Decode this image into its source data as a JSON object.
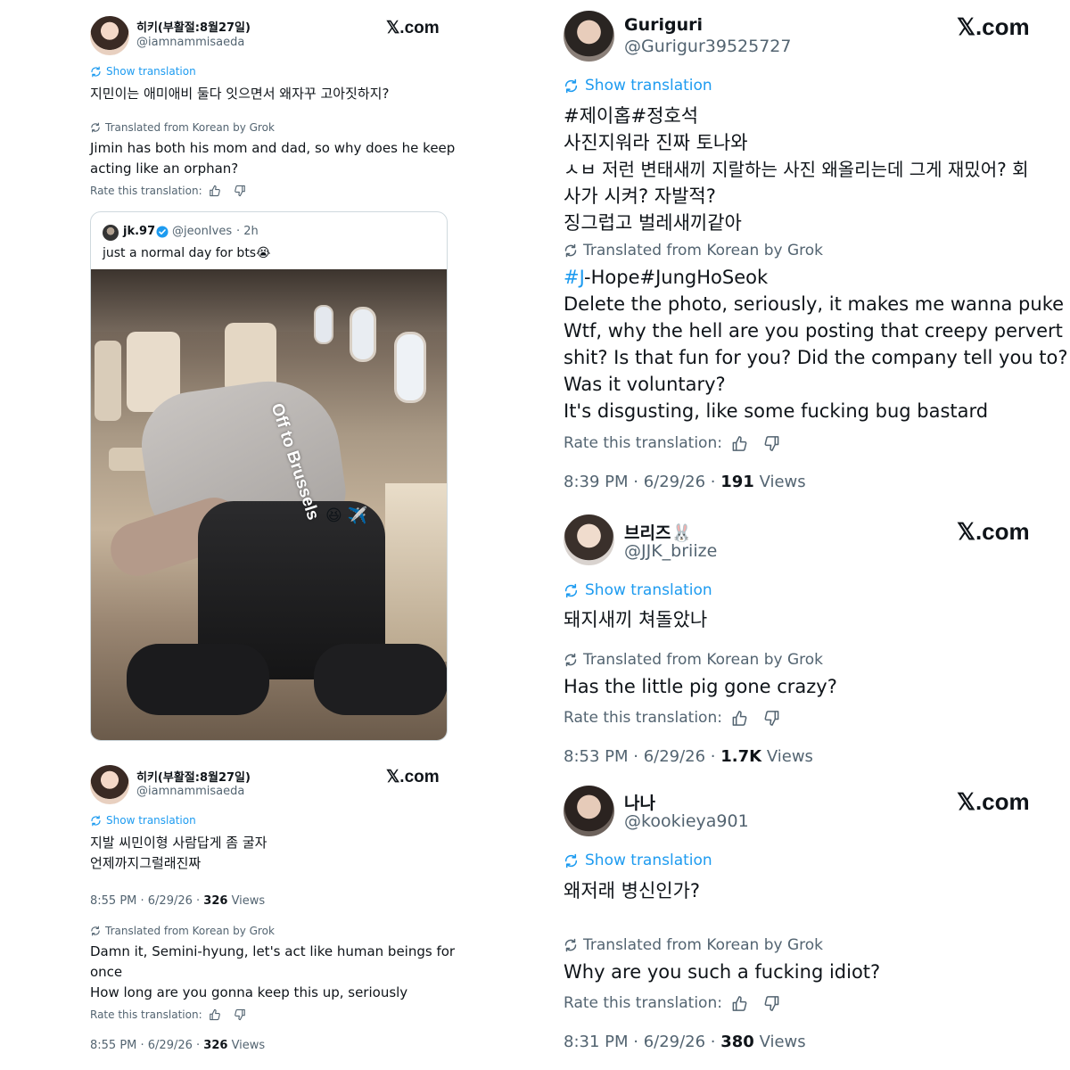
{
  "common": {
    "x_brand": "𝕏.com",
    "show_translation": "Show translation",
    "translated_from": "Translated from Korean by Grok",
    "rate_translation": "Rate this translation:",
    "views_label": "Views"
  },
  "left_top": {
    "name": "히키(부활절:8월27일)",
    "handle": "@iamnammisaeda",
    "original": [
      "지민이는 애미애비 둘다 잇으면서 왜자꾸 고아짓하지?"
    ],
    "translation": [
      "Jimin has both his mom and dad, so why does he keep",
      "acting like an orphan?"
    ]
  },
  "quoted": {
    "name": "jk.97",
    "handle": "@jeonIves",
    "time": "· 2h",
    "text": "just a normal day for bts😭",
    "overlay_text": "Off to Brussels",
    "overlay_emoji": "😆 ✈️"
  },
  "left_bottom": {
    "name": "히키(부활절:8월27일)",
    "handle": "@iamnammisaeda",
    "original": [
      "지발 씨민이형 사람답게 좀 굴자",
      "언제까지그럴래진짜"
    ],
    "meta1": {
      "time": "8:55 PM · 6/29/26 · ",
      "views": "326"
    },
    "translation": [
      "Damn it, Semini-hyung, let's act like human beings for",
      "once",
      "How long are you gonna keep this up, seriously"
    ],
    "meta2": {
      "time": "8:55 PM · 6/29/26 · ",
      "views": "326"
    }
  },
  "guriguri": {
    "name": "Guriguri",
    "handle": "@Gurigur39525727",
    "original": [
      "#제이홉#정호석",
      "사진지워라 진짜 토나와",
      "ㅅㅂ 저런 변태새끼 지랄하는 사진 왜올리는데 그게 재밌어? 회",
      "사가 시켜? 자발적?",
      "징그럽고 벌레새끼같아"
    ],
    "translation_hash": "#J",
    "translation_first_rest": "-Hope#JungHoSeok",
    "translation": [
      "Delete the photo, seriously, it makes me wanna puke",
      "Wtf, why the hell are you posting that creepy pervert",
      "shit? Is that fun for you? Did the company tell you to?",
      "Was it voluntary?",
      "It's disgusting, like some fucking bug bastard"
    ],
    "meta": {
      "time": "8:39 PM · 6/29/26 · ",
      "views": "191"
    }
  },
  "briize": {
    "name": "브리즈🐰",
    "handle": "@JJK_briize",
    "original": [
      "돼지새끼 쳐돌았나"
    ],
    "translation": [
      "Has the little pig gone crazy?"
    ],
    "meta": {
      "time": "8:53 PM · 6/29/26 · ",
      "views": "1.7K"
    }
  },
  "nana": {
    "name": "나나",
    "handle": "@kookieya901",
    "original": [
      "왜저래 병신인가?"
    ],
    "translation": [
      "Why are you such a fucking idiot?"
    ],
    "meta": {
      "time": "8:31 PM · 6/29/26 · ",
      "views": "380"
    }
  }
}
